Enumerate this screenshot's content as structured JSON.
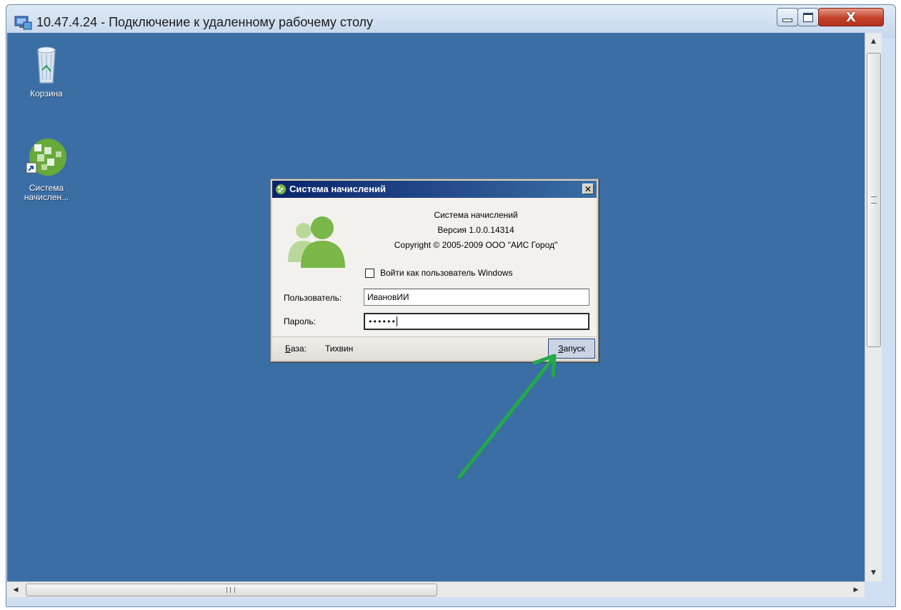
{
  "window": {
    "title": "10.47.4.24 - Подключение к удаленному рабочему столу",
    "close_glyph": "X"
  },
  "desktop": {
    "background": "#3b6ea5",
    "icons": [
      {
        "label": "Корзина",
        "icon": "recycle-bin-icon"
      },
      {
        "label_line1": "Система",
        "label_line2": "начислен...",
        "icon": "app-shortcut-icon"
      }
    ]
  },
  "dialog": {
    "title": "Система начислений",
    "close_glyph": "✕",
    "about_name": "Система начислений",
    "about_version": "Версия 1.0.0.14314",
    "about_copyright": "Copyright © 2005-2009 ООО \"АИС Город\"",
    "windows_login_label": "Войти как пользователь Windows",
    "windows_login_checked": false,
    "user_label": "Пользователь:",
    "user_value": "ИвановИИ",
    "password_label": "Пароль:",
    "password_value": "••••••",
    "base_label_first": "Б",
    "base_label_rest": "аза:",
    "base_value": "Тихвин",
    "run_first": "З",
    "run_rest": "апуск"
  },
  "colors": {
    "desktop": "#3b6ea5",
    "dialog_title": "#0a246a",
    "arrow": "#22a94a",
    "user_icon": "#7ab648"
  }
}
